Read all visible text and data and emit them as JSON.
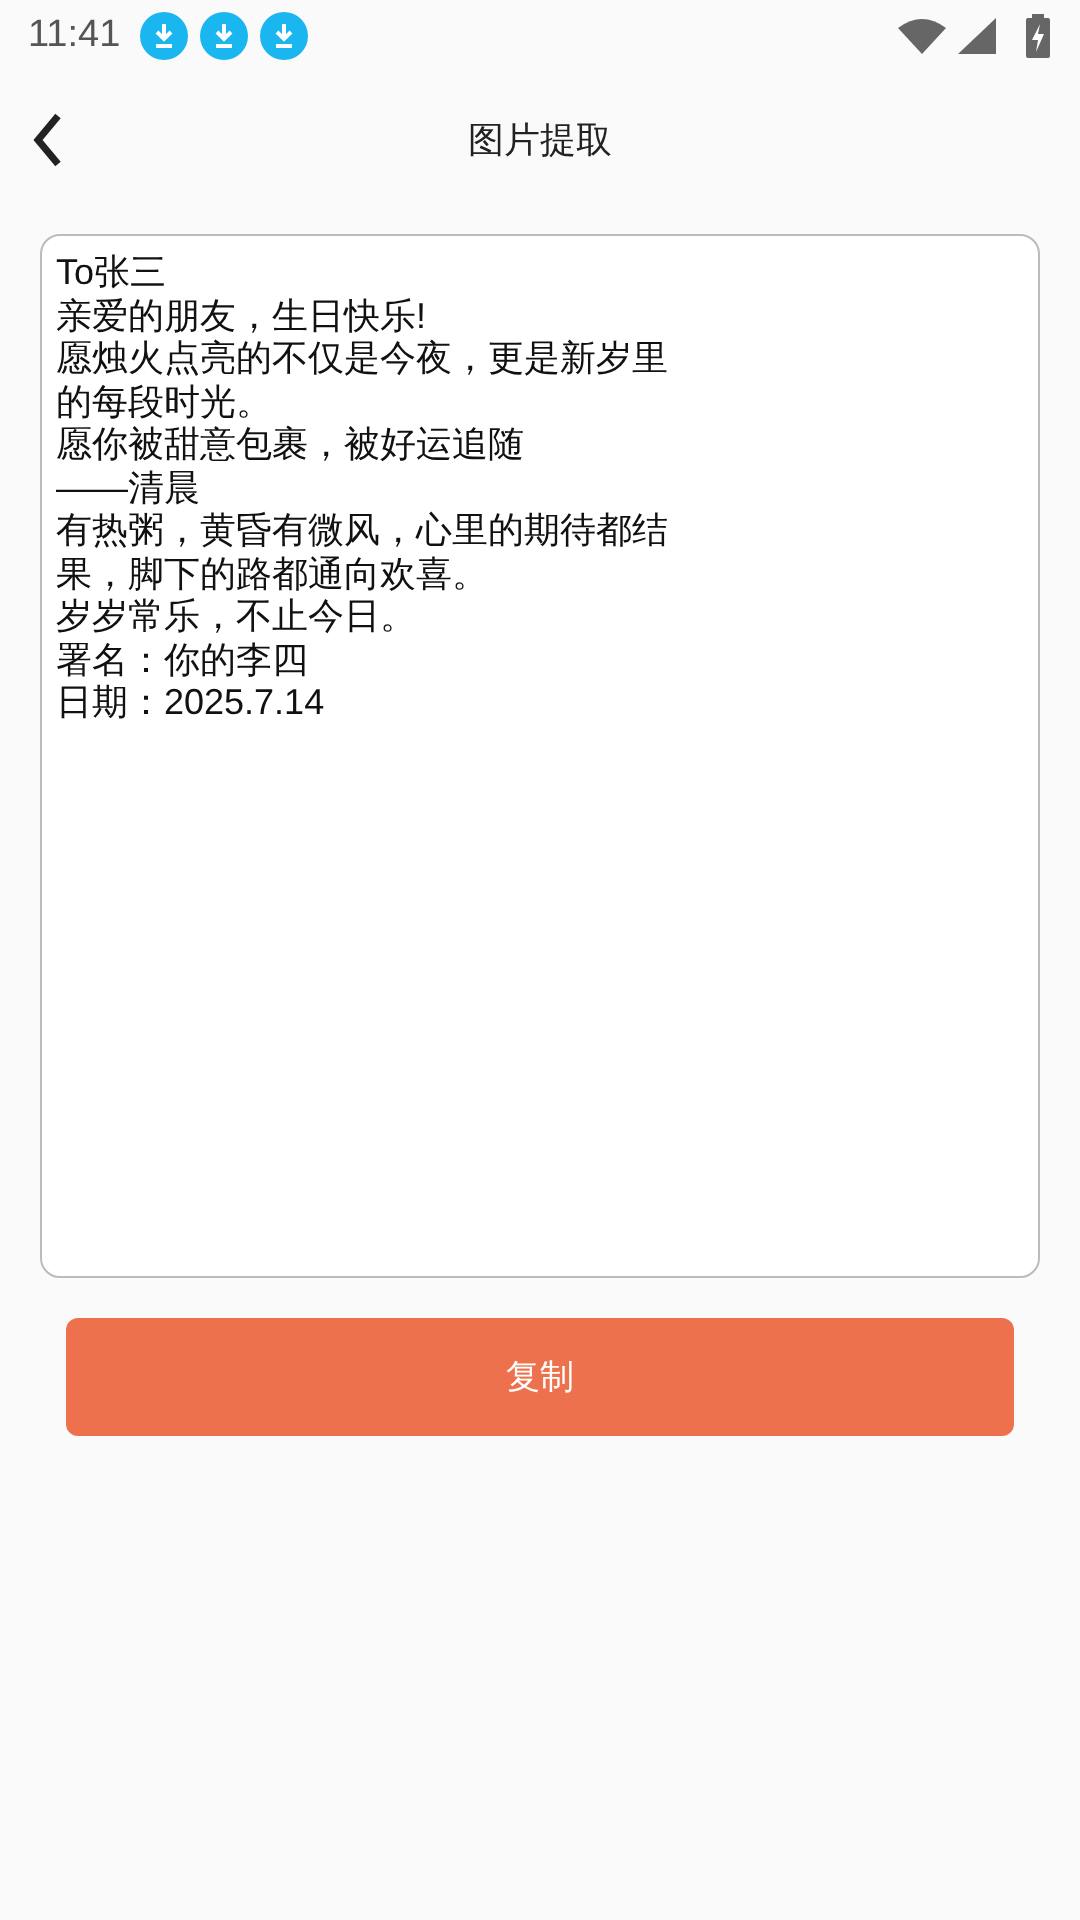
{
  "status_bar": {
    "time": "11:41",
    "notifications": [
      {
        "kind": "download"
      },
      {
        "kind": "download"
      },
      {
        "kind": "download"
      }
    ]
  },
  "header": {
    "title": "图片提取"
  },
  "text_field": {
    "lines": [
      "To张三",
      "亲爱的朋友，生日快乐!",
      "愿烛火点亮的不仅是今夜，更是新岁里",
      "的每段时光。",
      "愿你被甜意包裹，被好运追随",
      "——清晨",
      "有热粥，黄昏有微风，心里的期待都结",
      "果，脚下的路都通向欢喜。",
      "岁岁常乐，不止今日。",
      "署名：你的李四",
      "日期：2025.7.14"
    ]
  },
  "copy_button": {
    "label": "复制"
  }
}
